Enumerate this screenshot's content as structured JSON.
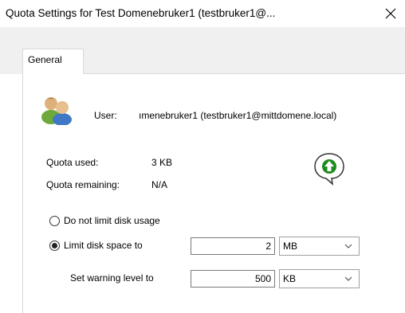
{
  "window": {
    "title": "Quota Settings for Test Domenebruker1 (testbruker1@..."
  },
  "tabs": [
    {
      "label": "General"
    }
  ],
  "user": {
    "label": "User:",
    "value": "ımenebruker1 (testbruker1@mittdomene.local)"
  },
  "quota": {
    "used_label": "Quota used:",
    "used_value": "3 KB",
    "remaining_label": "Quota remaining:",
    "remaining_value": "N/A"
  },
  "options": {
    "no_limit_label": "Do not limit disk usage",
    "limit_label": "Limit disk space to",
    "limit_value": "2",
    "limit_unit": "MB",
    "warning_label": "Set warning level to",
    "warning_value": "500",
    "warning_unit": "KB",
    "selected": "limit"
  },
  "colors": {
    "status_arrow": "#1e8a1e",
    "border": "#d9d9d9"
  }
}
